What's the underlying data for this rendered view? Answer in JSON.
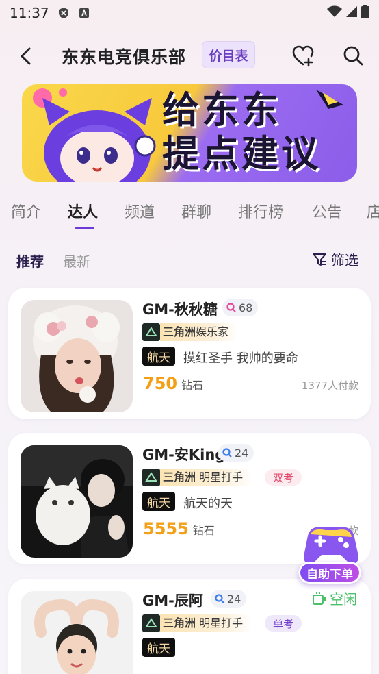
{
  "status": {
    "time": "11:37"
  },
  "header": {
    "title": "东东电竞俱乐部",
    "price_label": "价目表"
  },
  "banner": {
    "line1": "给东东",
    "line2": "提点建议"
  },
  "tabs": [
    "简介",
    "达人",
    "频道",
    "群聊",
    "排行榜",
    "公告",
    "店"
  ],
  "active_tab": "达人",
  "subtabs": {
    "recommend": "推荐",
    "latest": "最新",
    "filter": "筛选"
  },
  "cards": [
    {
      "name": "GM-秋秋糖",
      "level": "68",
      "team": "三角洲",
      "team_title": "娱乐家",
      "game": "航天",
      "desc": "摸红圣手 我帅的要命",
      "price": "750",
      "unit": "钻石",
      "paid": "1377人付款"
    },
    {
      "name": "GM-安King",
      "level": "24",
      "team": "三角洲",
      "team_title": "明星打手",
      "tag": "双考",
      "game": "航天",
      "desc": "航天的天",
      "price": "5555",
      "unit": "钻石",
      "paid": "1…款"
    },
    {
      "name": "GM-辰阿",
      "level": "24",
      "team": "三角洲",
      "team_title": "明星打手",
      "tag": "单考",
      "status": "空闲",
      "game": "航天"
    }
  ],
  "float_button": {
    "label": "自助下单"
  },
  "colors": {
    "accent": "#6c3bd6",
    "price": "#f3a018",
    "idle": "#4bc06b"
  }
}
